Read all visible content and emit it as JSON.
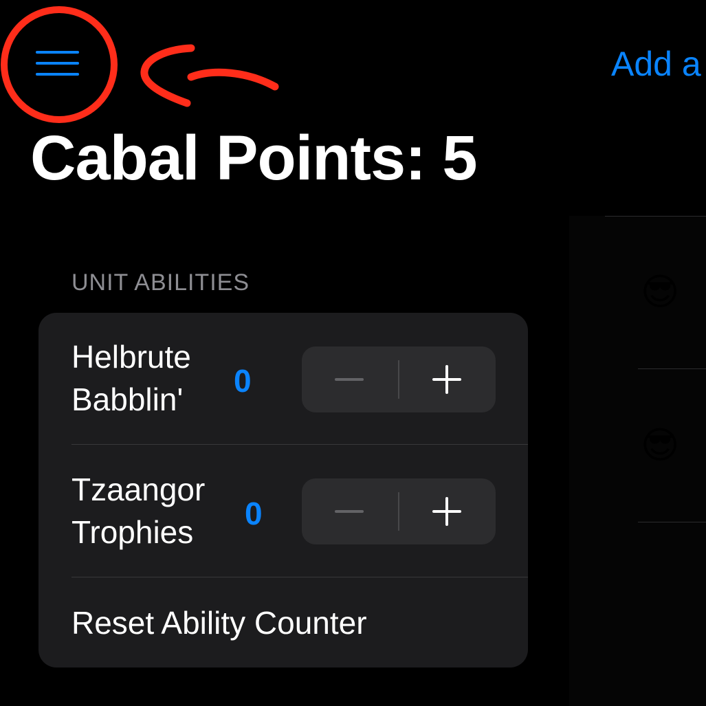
{
  "nav": {
    "menu_icon": "hamburger-menu-icon",
    "add_link": "Add a"
  },
  "title": "Cabal Points: 5",
  "popover": {
    "section_header": "UNIT ABILITIES",
    "rows": [
      {
        "label_line1": "Helbrute",
        "label_line2": "Babblin'",
        "count": "0"
      },
      {
        "label_line1": "Tzaangor",
        "label_line2": "Trophies",
        "count": "0"
      }
    ],
    "reset_label": "Reset Ability Counter"
  },
  "background_list": {
    "items": [
      {
        "emoji": "😎"
      },
      {
        "emoji": "😎"
      }
    ]
  },
  "colors": {
    "accent": "#0a84ff",
    "background": "#000000",
    "card": "#1c1c1e",
    "stepper": "#2c2c2e",
    "annotation": "#ff2d1a"
  }
}
